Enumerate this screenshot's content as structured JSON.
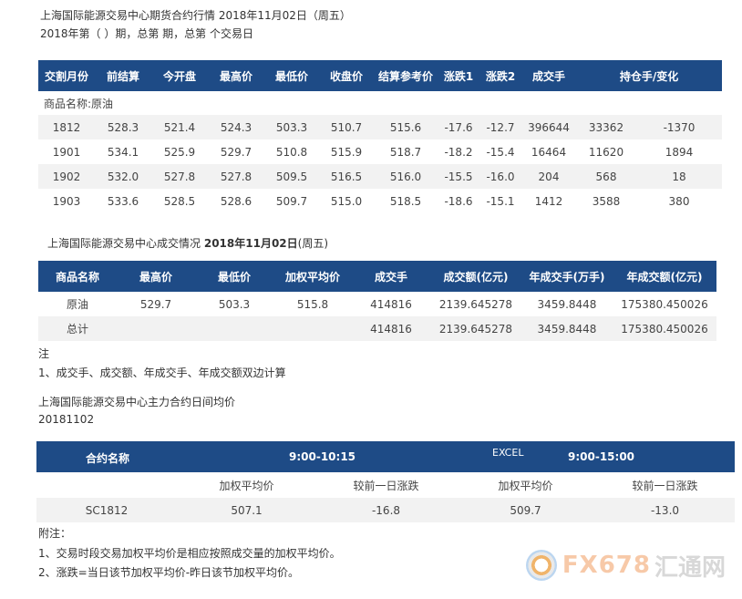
{
  "title1": "上海国际能源交易中心期货合约行情 2018年11月02日（周五）",
  "subtitle1": "2018年第（ ）期，总第 期，总第 个交易日",
  "table1": {
    "headers": [
      "交割月份",
      "前结算",
      "今开盘",
      "最高价",
      "最低价",
      "收盘价",
      "结算参考价",
      "涨跌1",
      "涨跌2",
      "成交手",
      "持仓手/变化"
    ],
    "product_label": "商品名称:原油",
    "rows": [
      [
        "1812",
        "528.3",
        "521.4",
        "524.3",
        "503.3",
        "510.7",
        "515.6",
        "-17.6",
        "-12.7",
        "396644",
        "33362",
        "-1370"
      ],
      [
        "1901",
        "534.1",
        "525.9",
        "529.7",
        "510.8",
        "515.9",
        "518.7",
        "-18.2",
        "-15.4",
        "16464",
        "11620",
        "1894"
      ],
      [
        "1902",
        "532.0",
        "527.8",
        "527.8",
        "509.5",
        "516.5",
        "516.0",
        "-15.5",
        "-16.0",
        "204",
        "568",
        "18"
      ],
      [
        "1903",
        "533.6",
        "528.5",
        "528.6",
        "509.7",
        "515.0",
        "518.5",
        "-18.6",
        "-15.1",
        "1412",
        "3588",
        "380"
      ]
    ]
  },
  "title2_prefix": "上海国际能源交易中心成交情况",
  "title2_date": "2018年11月02日",
  "title2_suffix": "(周五)",
  "table2": {
    "headers": [
      "商品名称",
      "最高价",
      "最低价",
      "加权平均价",
      "成交手",
      "成交额(亿元)",
      "年成交手(万手)",
      "年成交额(亿元)"
    ],
    "rows": [
      [
        "原油",
        "529.7",
        "503.3",
        "515.8",
        "414816",
        "2139.645278",
        "3459.8448",
        "175380.450026"
      ],
      [
        "总计",
        "",
        "",
        "",
        "414816",
        "2139.645278",
        "3459.8448",
        "175380.450026"
      ]
    ]
  },
  "note_label": "注",
  "note_line": "1、成交手、成交额、年成交手、年成交额双边计算",
  "title3": "上海国际能源交易中心主力合约日间均价",
  "date3": "20181102",
  "table3": {
    "header_contract": "合约名称",
    "header_session1": "9:00-10:15",
    "header_excel": "EXCEL",
    "header_session2": "9:00-15:00",
    "sub_headers": [
      "加权平均价",
      "较前一日涨跌",
      "加权平均价",
      "较前一日涨跌"
    ],
    "row": [
      "SC1812",
      "507.1",
      "-16.8",
      "509.7",
      "-13.0"
    ]
  },
  "footnote_label": "附注：",
  "footnote1": "1、交易时段交易加权平均价是相应按照成交量的加权平均价。",
  "footnote2": "2、涨跌=当日该节加权平均价-昨日该节加权平均价。",
  "watermark_text": "FX678",
  "watermark_cn": "汇通网",
  "colors": {
    "header_bg": "#1e4b86",
    "row_alt": "#f2f2f2"
  }
}
